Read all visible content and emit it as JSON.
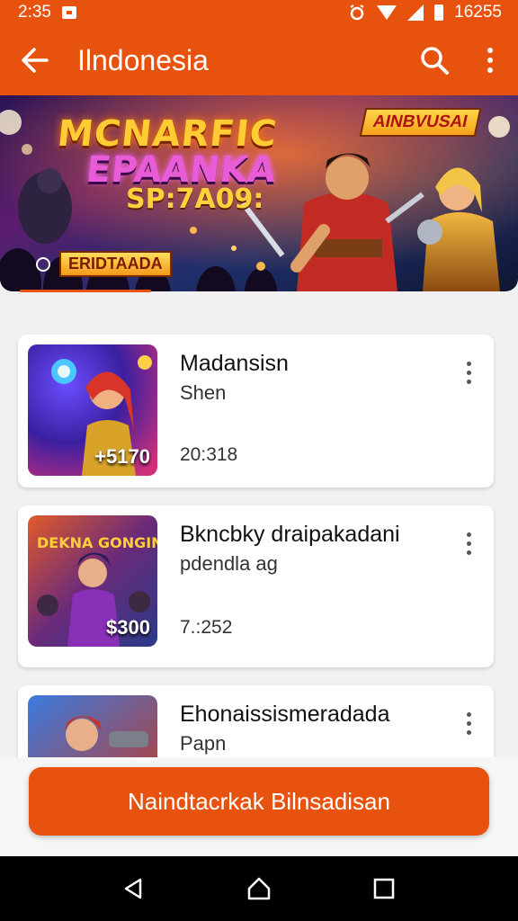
{
  "status_bar": {
    "time": "2:35",
    "right_text": "16255"
  },
  "app_bar": {
    "title": "Ilndonesia"
  },
  "banner": {
    "title_line1": "MCNARFIC",
    "title_line2": "EPAANKA",
    "title_line3": "SP:7A09:",
    "tag": "AINBVUSAI",
    "bottom_label": "ERIDTAADA"
  },
  "games": [
    {
      "title": "Madansisn",
      "subtitle": "Shen",
      "meta": "20:318",
      "price": "+5170"
    },
    {
      "title": "Bkncbky draipakadani",
      "subtitle": "pdendla ag",
      "meta": "7.:252",
      "price": "$300",
      "thumb_text": "DEKNA GONGIN"
    },
    {
      "title": "Ehonaissismeradada",
      "subtitle": "Papn"
    }
  ],
  "cta": {
    "label": "Naindtacrkak Bilnsadisan"
  },
  "icons": [
    "back-icon",
    "search-icon",
    "more-vertical-icon",
    "wifi-icon",
    "signal-icon",
    "battery-icon",
    "nav-back-icon",
    "nav-home-icon",
    "nav-recents-icon"
  ],
  "colors": {
    "accent": "#e8520f",
    "background": "#f1f1f1",
    "card": "#ffffff",
    "nav_bar": "#000000"
  }
}
